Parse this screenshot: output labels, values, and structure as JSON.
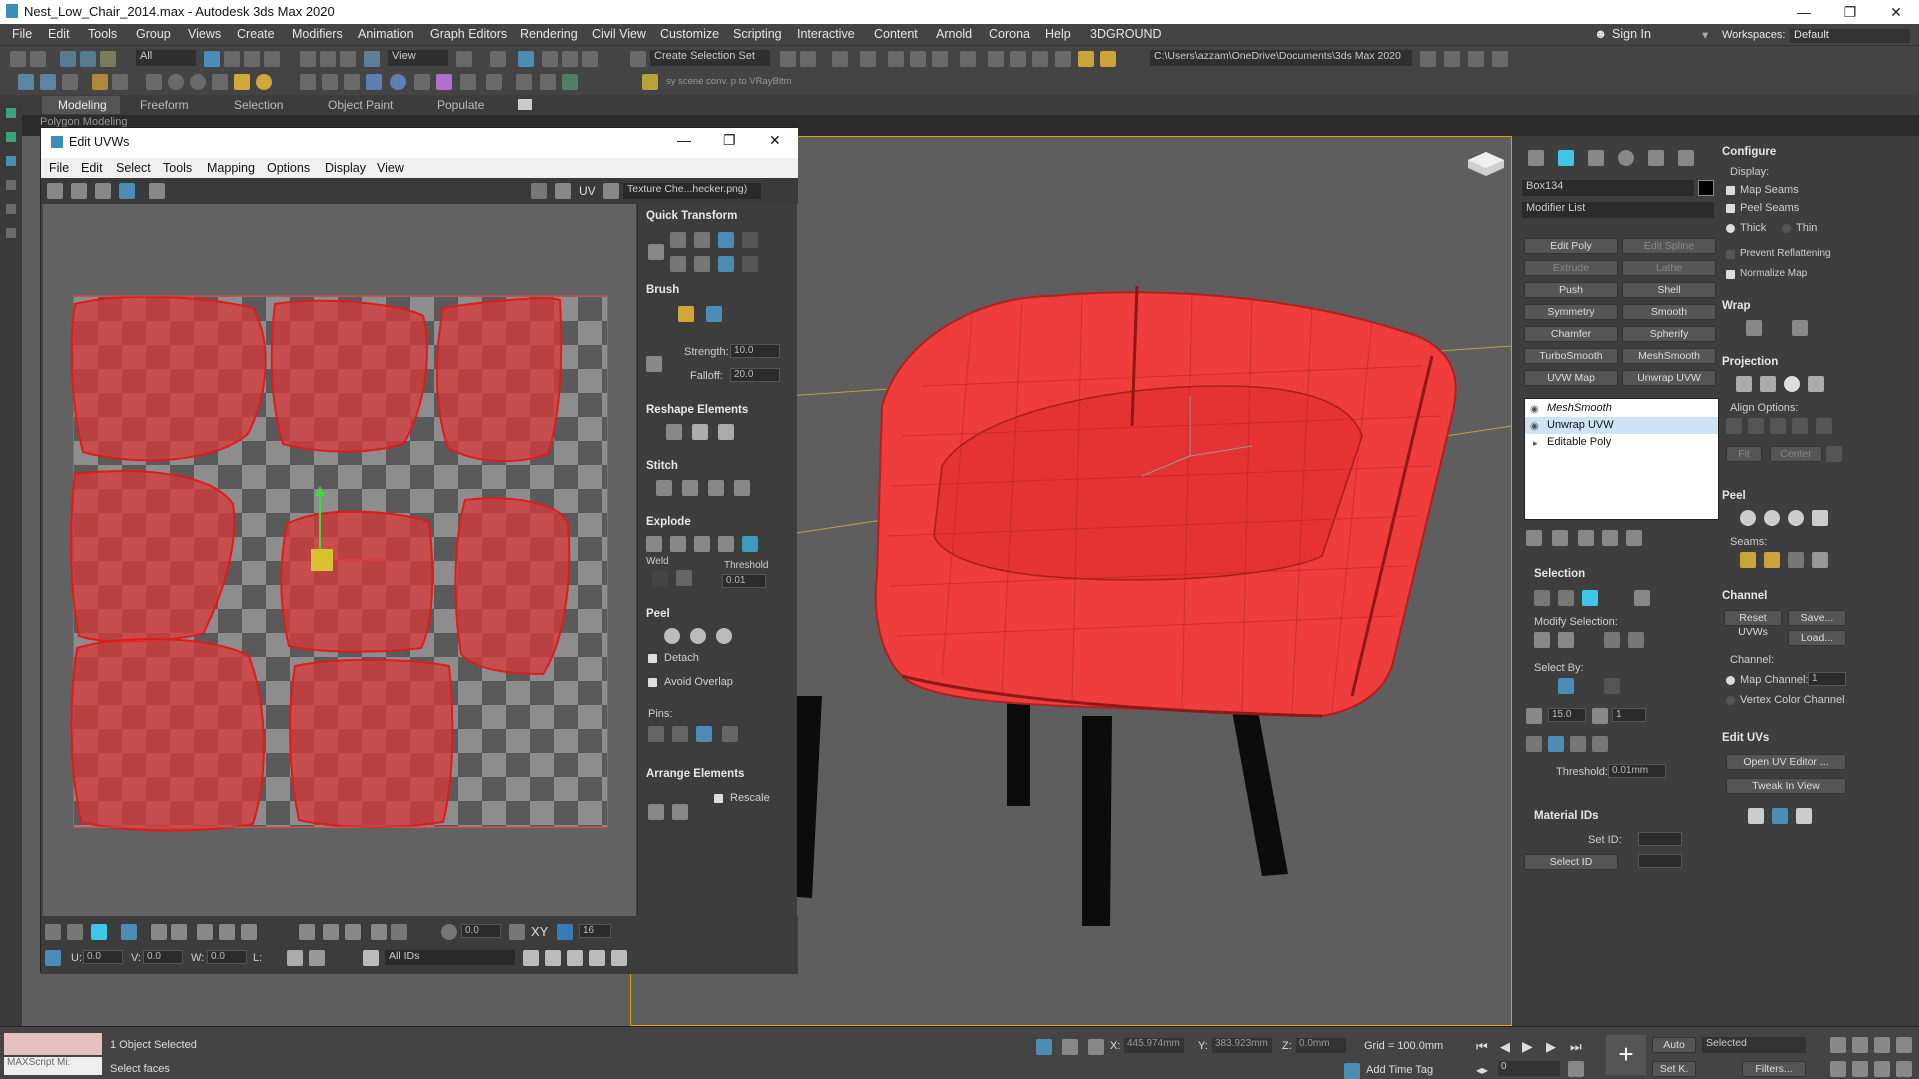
{
  "window": {
    "title": "Nest_Low_Chair_2014.max - Autodesk 3ds Max 2020",
    "minimize": "—",
    "maximize": "❐",
    "close": "✕"
  },
  "menu": [
    "File",
    "Edit",
    "Tools",
    "Group",
    "Views",
    "Create",
    "Modifiers",
    "Animation",
    "Graph Editors",
    "Rendering",
    "Civil View",
    "Customize",
    "Scripting",
    "Interactive",
    "Content",
    "Arnold",
    "Corona",
    "Help",
    "3DGROUND"
  ],
  "account": {
    "sign_in": "Sign In",
    "workspaces_label": "Workspaces:",
    "workspace": "Default"
  },
  "toolbar": {
    "filter": "All",
    "view": "View",
    "selection_set": "Create Selection Set",
    "path": "C:\\Users\\azzam\\OneDrive\\Documents\\3ds Max 2020",
    "scene_conv": "sy scene conv. p to VRayBitm"
  },
  "ribbon": {
    "tabs": [
      "Modeling",
      "Freeform",
      "Selection",
      "Object Paint",
      "Populate"
    ],
    "sub": "Polygon Modeling"
  },
  "uv_editor": {
    "title": "Edit UVWs",
    "menu": [
      "File",
      "Edit",
      "Select",
      "Tools",
      "Mapping",
      "Options",
      "Display",
      "View"
    ],
    "uv_label": "UV",
    "texture": "Texture Che...hecker.png)",
    "panel": {
      "quick_transform": "Quick Transform",
      "brush": "Brush",
      "strength_label": "Strength:",
      "strength": "10.0",
      "falloff_label": "Falloff:",
      "falloff": "20.0",
      "reshape": "Reshape Elements",
      "stitch": "Stitch",
      "explode": "Explode",
      "weld": "Weld",
      "threshold_label": "Threshold",
      "threshold": "0.01",
      "peel": "Peel",
      "detach": "Detach",
      "avoid_overlap": "Avoid Overlap",
      "pins": "Pins:",
      "arrange": "Arrange Elements",
      "rescale": "Rescale"
    },
    "bottom": {
      "angle": "0.0",
      "spin16": "16",
      "u_label": "U:",
      "u": "0.0",
      "v_label": "V:",
      "v": "0.0",
      "w_label": "W:",
      "w": "0.0",
      "l_label": "L:",
      "ids": "All IDs",
      "xy": "XY"
    }
  },
  "command_panel": {
    "object_name": "Box134",
    "modifier_list": "Modifier List",
    "mod_buttons": [
      "Edit Poly",
      "Edit Spline",
      "Extrude",
      "Lathe",
      "Push",
      "Shell",
      "Symmetry",
      "Smooth",
      "Chamfer",
      "Spherify",
      "TurboSmooth",
      "MeshSmooth",
      "UVW Map",
      "Unwrap UVW"
    ],
    "stack": [
      "MeshSmooth",
      "Unwrap UVW",
      "Editable Poly"
    ],
    "selection": {
      "title": "Selection",
      "modify": "Modify Selection:",
      "select_by": "Select By:",
      "angle": "15.0",
      "count": "1",
      "threshold_label": "Threshold:",
      "threshold": "0.01mm"
    },
    "material_ids": {
      "title": "Material IDs",
      "set_id": "Set ID:",
      "select_id": "Select ID"
    },
    "configure": {
      "title": "Configure",
      "display": "Display:",
      "map_seams": "Map Seams",
      "peel_seams": "Peel Seams",
      "thick": "Thick",
      "thin": "Thin",
      "prevent": "Prevent Reflattening",
      "normalize": "Normalize Map"
    },
    "wrap": "Wrap",
    "projection": "Projection",
    "align": "Align Options:",
    "fit": "Fit",
    "center": "Center",
    "peel": "Peel",
    "seams": "Seams:",
    "channel": {
      "title": "Channel",
      "reset": "Reset UVWs",
      "save": "Save...",
      "load": "Load...",
      "label": "Channel:",
      "map_channel": "Map Channel:",
      "map_channel_value": "1",
      "vertex_color": "Vertex Color Channel"
    },
    "edit_uvs": {
      "title": "Edit UVs",
      "open": "Open UV Editor ...",
      "tweak": "Tweak In View"
    }
  },
  "status": {
    "maxscript": "MAXScript Mi:",
    "objects": "1 Object Selected",
    "prompt": "Select faces",
    "x_label": "X:",
    "x": "445.974mm",
    "y_label": "Y:",
    "y": "383.923mm",
    "z_label": "Z:",
    "z": "0.0mm",
    "grid": "Grid = 100.0mm",
    "add_time_tag": "Add Time Tag",
    "auto": "Auto",
    "selected": "Selected",
    "setk": "Set K.",
    "filters": "Filters...",
    "frame": "0"
  },
  "colors": {
    "accent": "#3ec6e8",
    "uv_shell": "#d93a3a",
    "chair": "#ee3b3b",
    "viewport_border": "#d9a300"
  }
}
